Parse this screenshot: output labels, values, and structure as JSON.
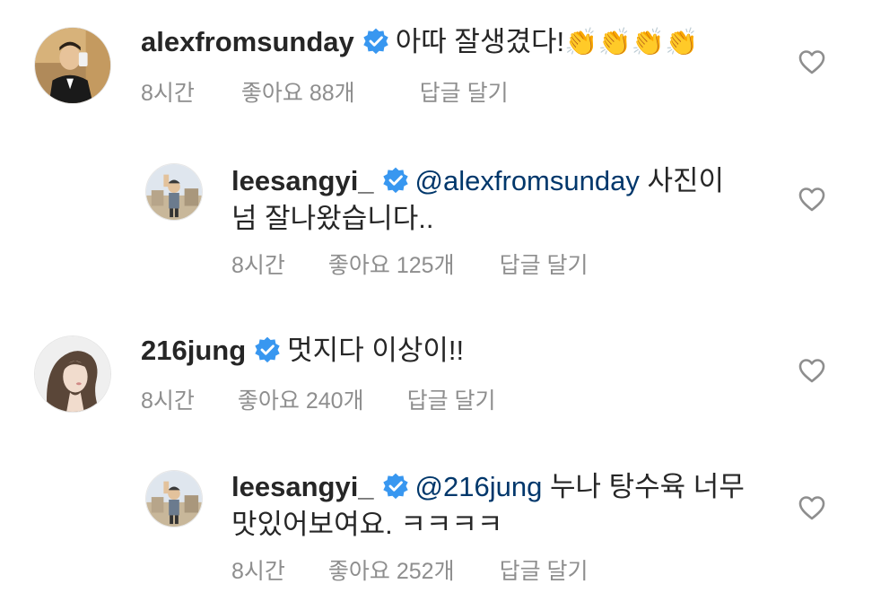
{
  "colors": {
    "verified": "#3897f0",
    "text": "#262626",
    "meta": "#8e8e8e",
    "mention": "#00376b"
  },
  "comments": [
    {
      "username": "alexfromsunday",
      "text": "아따 잘생겼다!",
      "emoji": "👏👏👏👏",
      "time": "8시간",
      "likes": "좋아요 88개",
      "reply": "답글 달기"
    },
    {
      "username": "leesangyi_",
      "mention": "@alexfromsunday",
      "text_line1": "사진이",
      "text_line2": "넘 잘나왔습니다..",
      "time": "8시간",
      "likes": "좋아요 125개",
      "reply": "답글 달기"
    },
    {
      "username": "216jung",
      "text": "멋지다 이상이!!",
      "time": "8시간",
      "likes": "좋아요 240개",
      "reply": "답글 달기"
    },
    {
      "username": "leesangyi_",
      "mention": "@216jung",
      "text_line1": "누나 탕수육 너무",
      "text_line2": "맛있어보여요. ㅋㅋㅋㅋ",
      "time": "8시간",
      "likes": "좋아요 252개",
      "reply": "답글 달기"
    }
  ]
}
